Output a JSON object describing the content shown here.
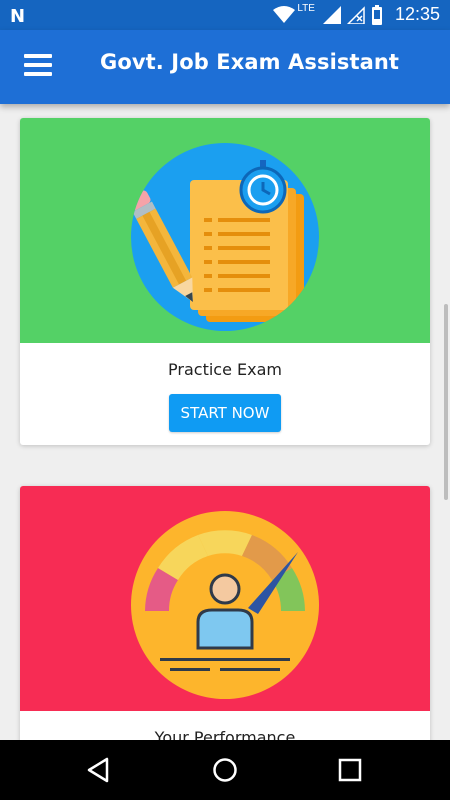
{
  "status_bar": {
    "network_label": "LTE",
    "time": "12:35"
  },
  "app_bar": {
    "title": "Govt. Job Exam Assistant"
  },
  "cards": [
    {
      "title": "Practice Exam",
      "button": "START NOW",
      "color": "#54d166",
      "image": "exam-papers-clock-pencil-icon"
    },
    {
      "title": "Your Performance",
      "color": "#f72c54",
      "image": "performance-gauge-person-icon"
    }
  ],
  "colors": {
    "appbar": "#1e6fd6",
    "statusbar": "#1565c0",
    "button": "#0f9bf3"
  }
}
